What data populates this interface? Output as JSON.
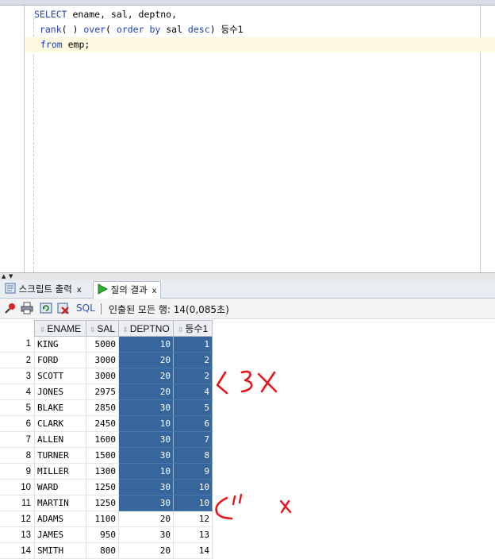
{
  "editor": {
    "line1": {
      "kw1": "SELECT",
      "rest": " ename, sal, deptno,"
    },
    "line2": {
      "kw1": "rank",
      "p1": "( ) ",
      "kw2": "over",
      "p2": "( ",
      "kw3": "order by",
      "p3": " sal ",
      "kw4": "desc",
      "p4": ") ",
      "alias": "등수1"
    },
    "line3": {
      "kw1": "from",
      "rest": " emp;"
    }
  },
  "tabs": [
    {
      "label": "스크립트 출력",
      "close": "x",
      "icon": "script-output-icon"
    },
    {
      "label": "질의 결과",
      "close": "x",
      "icon": "run-query-icon"
    }
  ],
  "toolbar": {
    "icons": [
      "pin-icon",
      "print-icon",
      "refresh-icon",
      "delete-icon"
    ],
    "sql_label": "SQL",
    "status": "인출된 모든 행: 14(0,085초)"
  },
  "grid": {
    "columns": [
      "ENAME",
      "SAL",
      "DEPTNO",
      "등수1"
    ],
    "rows": [
      [
        "1",
        "KING",
        "5000",
        "10",
        "1"
      ],
      [
        "2",
        "FORD",
        "3000",
        "20",
        "2"
      ],
      [
        "3",
        "SCOTT",
        "3000",
        "20",
        "2"
      ],
      [
        "4",
        "JONES",
        "2975",
        "20",
        "4"
      ],
      [
        "5",
        "BLAKE",
        "2850",
        "30",
        "5"
      ],
      [
        "6",
        "CLARK",
        "2450",
        "10",
        "6"
      ],
      [
        "7",
        "ALLEN",
        "1600",
        "30",
        "7"
      ],
      [
        "8",
        "TURNER",
        "1500",
        "30",
        "8"
      ],
      [
        "9",
        "MILLER",
        "1300",
        "10",
        "9"
      ],
      [
        "10",
        "WARD",
        "1250",
        "30",
        "10"
      ],
      [
        "11",
        "MARTIN",
        "1250",
        "30",
        "10"
      ],
      [
        "12",
        "ADAMS",
        "1100",
        "20",
        "12"
      ],
      [
        "13",
        "JAMES",
        "950",
        "30",
        "13"
      ],
      [
        "14",
        "SMITH",
        "800",
        "20",
        "14"
      ]
    ],
    "selected_rows": 11
  },
  "colors": {
    "selection": "#36669b",
    "keyword": "#1f3fb5",
    "annotation": "#e8141b"
  }
}
